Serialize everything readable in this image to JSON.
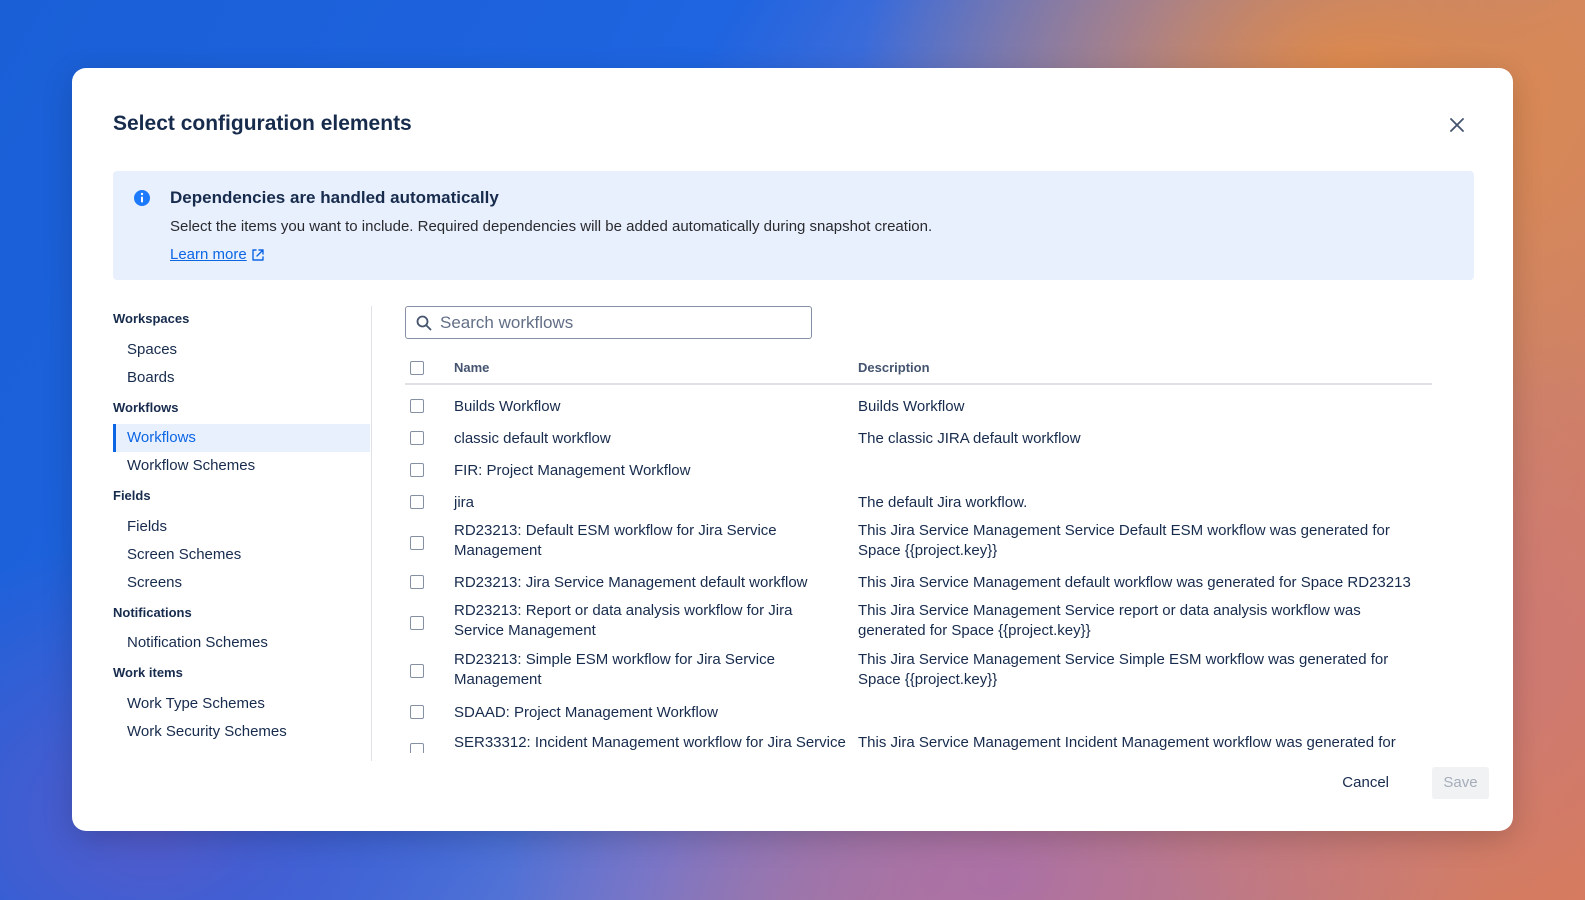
{
  "modal": {
    "title": "Select configuration elements",
    "close_icon": "close-icon"
  },
  "banner": {
    "icon": "info-icon",
    "title": "Dependencies are handled automatically",
    "text": "Select the items you want to include. Required dependencies will be added automatically during snapshot creation.",
    "link_label": "Learn more",
    "link_icon": "external-link-icon"
  },
  "sidebar": {
    "groups": [
      {
        "label": "Workspaces",
        "items": [
          {
            "label": "Spaces"
          },
          {
            "label": "Boards"
          }
        ]
      },
      {
        "label": "Workflows",
        "items": [
          {
            "label": "Workflows",
            "active": true
          },
          {
            "label": "Workflow Schemes"
          }
        ]
      },
      {
        "label": "Fields",
        "items": [
          {
            "label": "Fields"
          },
          {
            "label": "Screen Schemes"
          },
          {
            "label": "Screens"
          }
        ]
      },
      {
        "label": "Notifications",
        "items": [
          {
            "label": "Notification Schemes"
          }
        ]
      },
      {
        "label": "Work items",
        "items": [
          {
            "label": "Work Type Schemes"
          },
          {
            "label": "Work Security Schemes"
          }
        ]
      }
    ]
  },
  "search": {
    "placeholder": "Search workflows",
    "icon": "search-icon"
  },
  "table": {
    "headers": {
      "name": "Name",
      "description": "Description"
    },
    "rows": [
      {
        "name": "Builds Workflow",
        "description": "Builds Workflow"
      },
      {
        "name": "classic default workflow",
        "description": "The classic JIRA default workflow"
      },
      {
        "name": "FIR: Project Management Workflow",
        "description": ""
      },
      {
        "name": "jira",
        "description": "The default Jira workflow."
      },
      {
        "name": "RD23213: Default ESM workflow for Jira Service Management",
        "description": "This Jira Service Management Service Default ESM workflow was generated for Space {{project.key}}"
      },
      {
        "name": "RD23213: Jira Service Management default workflow",
        "description": "This Jira Service Management default workflow was generated for Space RD23213"
      },
      {
        "name": "RD23213: Report or data analysis workflow for Jira Service Management",
        "description": "This Jira Service Management Service report or data analysis workflow was generated for Space {{project.key}}"
      },
      {
        "name": "RD23213: Simple ESM workflow for Jira Service Management",
        "description": "This Jira Service Management Service Simple ESM workflow was generated for Space {{project.key}}"
      },
      {
        "name": "SDAAD: Project Management Workflow",
        "description": ""
      },
      {
        "name": "SER33312: Incident Management workflow for Jira Service",
        "description": "This Jira Service Management Incident Management workflow was generated for"
      }
    ]
  },
  "footer": {
    "cancel_label": "Cancel",
    "save_label": "Save"
  },
  "colors": {
    "accent": "#0c66e4",
    "banner_bg": "#e9f0fd"
  }
}
